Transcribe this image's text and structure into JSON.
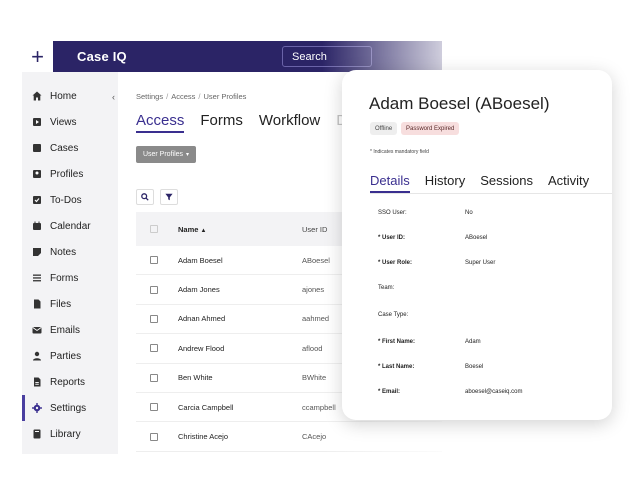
{
  "topbar": {
    "brand": "Case IQ",
    "search_label": "Search"
  },
  "sidebar": {
    "items": [
      {
        "label": "Home",
        "icon": "home-icon"
      },
      {
        "label": "Views",
        "icon": "views-icon"
      },
      {
        "label": "Cases",
        "icon": "cases-icon"
      },
      {
        "label": "Profiles",
        "icon": "profiles-icon"
      },
      {
        "label": "To-Dos",
        "icon": "todos-icon"
      },
      {
        "label": "Calendar",
        "icon": "calendar-icon"
      },
      {
        "label": "Notes",
        "icon": "notes-icon"
      },
      {
        "label": "Forms",
        "icon": "forms-icon"
      },
      {
        "label": "Files",
        "icon": "files-icon"
      },
      {
        "label": "Emails",
        "icon": "emails-icon"
      },
      {
        "label": "Parties",
        "icon": "parties-icon"
      },
      {
        "label": "Reports",
        "icon": "reports-icon"
      },
      {
        "label": "Settings",
        "icon": "gear-icon"
      },
      {
        "label": "Library",
        "icon": "library-icon"
      }
    ],
    "active_index": 12
  },
  "breadcrumb": {
    "items": [
      "Settings",
      "Access",
      "User Profiles"
    ]
  },
  "tabs": [
    "Access",
    "Forms",
    "Workflow",
    "Da"
  ],
  "profiles_button": "User Profiles",
  "table": {
    "headers": {
      "name": "Name",
      "user_id": "User ID"
    },
    "rows": [
      {
        "name": "Adam Boesel",
        "user_id": "ABoesel"
      },
      {
        "name": "Adam Jones",
        "user_id": "ajones"
      },
      {
        "name": "Adnan Ahmed",
        "user_id": "aahmed"
      },
      {
        "name": "Andrew Flood",
        "user_id": "aflood"
      },
      {
        "name": "Ben White",
        "user_id": "BWhite"
      },
      {
        "name": "Carcia Campbell",
        "user_id": "ccampbell"
      },
      {
        "name": "Christine Acejo",
        "user_id": "CAcejo"
      }
    ]
  },
  "panel": {
    "title": "Adam Boesel (ABoesel)",
    "badges": {
      "status": "Offline",
      "password": "Password Expired"
    },
    "note": "* Indicates mandatory field",
    "tabs": [
      "Details",
      "History",
      "Sessions",
      "Activity"
    ],
    "fields": [
      {
        "label": "SSO User:",
        "value": "No"
      },
      {
        "label": "* User ID:",
        "value": "ABoesel"
      },
      {
        "label": "* User Role:",
        "value": "Super User"
      },
      {
        "label": "Team:",
        "value": ""
      },
      {
        "label": "Case Type:",
        "value": ""
      },
      {
        "label": "* First Name:",
        "value": "Adam"
      },
      {
        "label": "* Last Name:",
        "value": "Boesel"
      },
      {
        "label": "* Email:",
        "value": "aboesel@caseiq.com"
      }
    ]
  },
  "colors": {
    "brand": "#2b2466",
    "accent": "#3a2f8f",
    "expired_badge": "#f7dede"
  }
}
